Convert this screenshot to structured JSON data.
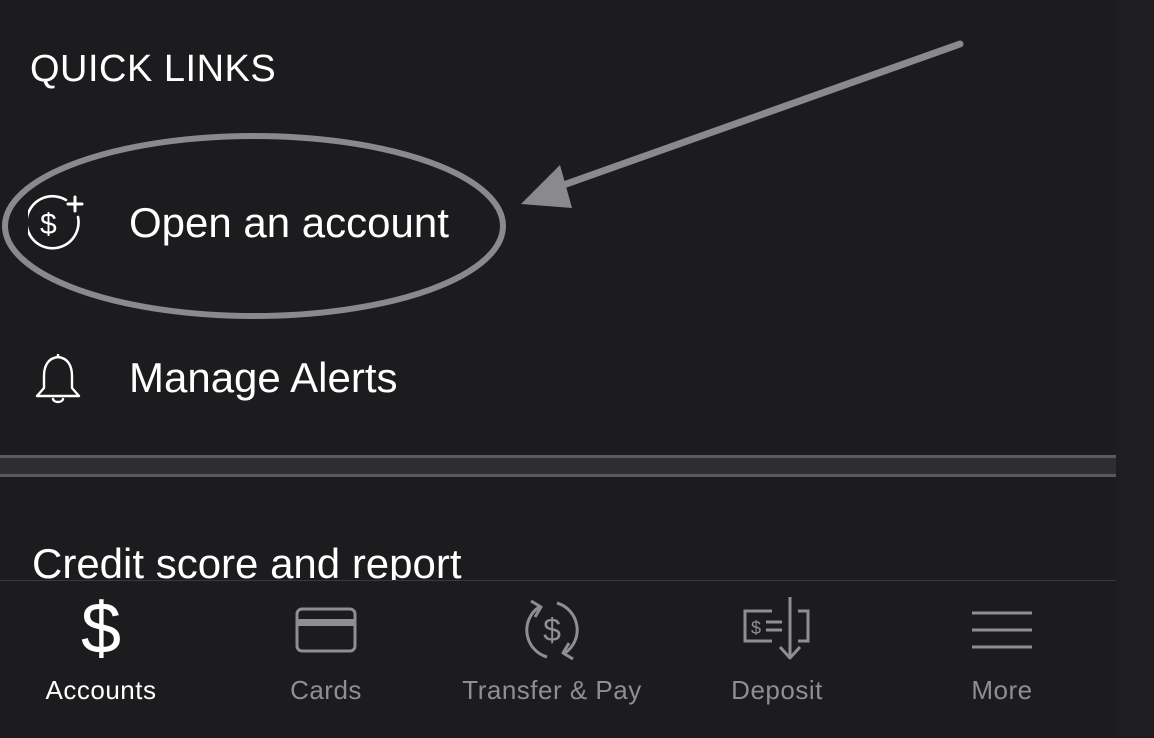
{
  "quick_links": {
    "title": "QUICK LINKS",
    "items": [
      {
        "label": "Open an account",
        "icon": "dollar-plus-icon"
      },
      {
        "label": "Manage Alerts",
        "icon": "bell-icon"
      }
    ]
  },
  "credit": {
    "label": "Credit score and report"
  },
  "tabbar": {
    "tabs": [
      {
        "label": "Accounts",
        "icon": "dollar-icon",
        "active": true
      },
      {
        "label": "Cards",
        "icon": "card-icon",
        "active": false
      },
      {
        "label": "Transfer & Pay",
        "icon": "transfer-icon",
        "active": false
      },
      {
        "label": "Deposit",
        "icon": "deposit-check-icon",
        "active": false
      },
      {
        "label": "More",
        "icon": "menu-icon",
        "active": false
      }
    ]
  },
  "colors": {
    "background": "#1c1c1e",
    "text": "#ffffff",
    "inactive": "#8e8e93",
    "annotation": "#8a8a8c"
  }
}
